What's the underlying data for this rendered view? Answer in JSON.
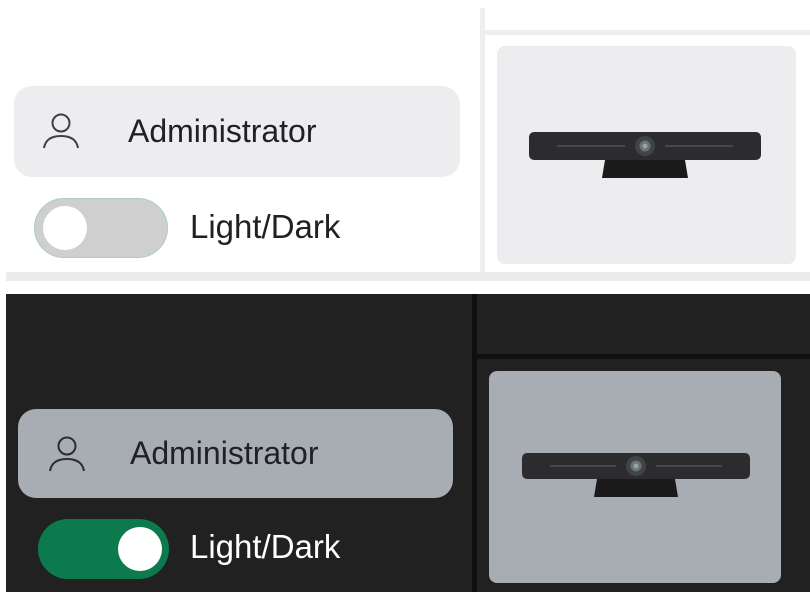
{
  "light": {
    "user": {
      "name": "Administrator",
      "icon": "user-icon"
    },
    "toggle": {
      "label": "Light/Dark",
      "checked": false,
      "track_color": "#cfcfcf"
    },
    "device": {
      "icon": "video-bar-camera-icon"
    },
    "colors": {
      "background": "#ffffff",
      "card": "#ededef",
      "divider": "#eeeeee"
    }
  },
  "dark": {
    "user": {
      "name": "Administrator",
      "icon": "user-icon"
    },
    "toggle": {
      "label": "Light/Dark",
      "checked": true,
      "track_color": "#0d7a4e"
    },
    "device": {
      "icon": "video-bar-camera-icon"
    },
    "colors": {
      "background": "#212121",
      "card": "#a8acb3",
      "divider": "#0f0f0f"
    }
  }
}
